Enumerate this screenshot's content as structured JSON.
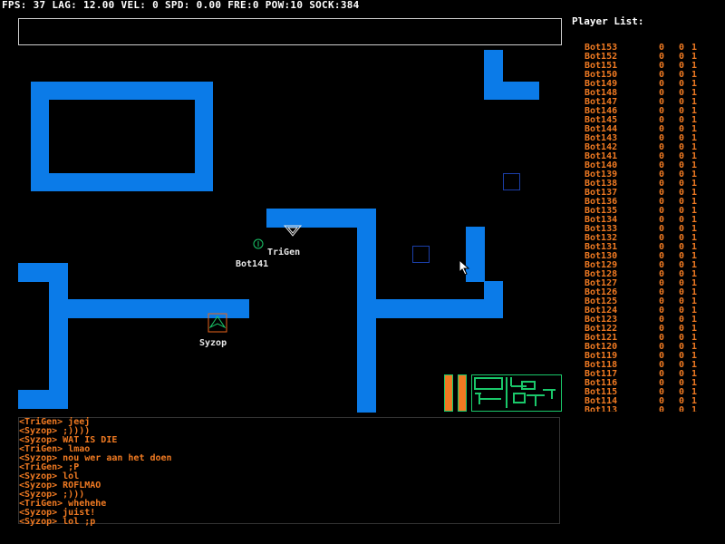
{
  "hud": {
    "text": "FPS: 37 LAG: 12.00 VEL: 0 SPD: 0.00 FRE:0 POW:10 SOCK:384"
  },
  "input": {
    "value": ""
  },
  "labels": {
    "trigen": "TriGen",
    "bot141": "Bot141",
    "syzop": "Syzop"
  },
  "player_list": {
    "title": "Player List:",
    "rows": [
      {
        "name": "Bot153",
        "a": "0",
        "b": "0",
        "c": "1"
      },
      {
        "name": "Bot152",
        "a": "0",
        "b": "0",
        "c": "1"
      },
      {
        "name": "Bot151",
        "a": "0",
        "b": "0",
        "c": "1"
      },
      {
        "name": "Bot150",
        "a": "0",
        "b": "0",
        "c": "1"
      },
      {
        "name": "Bot149",
        "a": "0",
        "b": "0",
        "c": "1"
      },
      {
        "name": "Bot148",
        "a": "0",
        "b": "0",
        "c": "1"
      },
      {
        "name": "Bot147",
        "a": "0",
        "b": "0",
        "c": "1"
      },
      {
        "name": "Bot146",
        "a": "0",
        "b": "0",
        "c": "1"
      },
      {
        "name": "Bot145",
        "a": "0",
        "b": "0",
        "c": "1"
      },
      {
        "name": "Bot144",
        "a": "0",
        "b": "0",
        "c": "1"
      },
      {
        "name": "Bot143",
        "a": "0",
        "b": "0",
        "c": "1"
      },
      {
        "name": "Bot142",
        "a": "0",
        "b": "0",
        "c": "1"
      },
      {
        "name": "Bot141",
        "a": "0",
        "b": "0",
        "c": "1"
      },
      {
        "name": "Bot140",
        "a": "0",
        "b": "0",
        "c": "1"
      },
      {
        "name": "Bot139",
        "a": "0",
        "b": "0",
        "c": "1"
      },
      {
        "name": "Bot138",
        "a": "0",
        "b": "0",
        "c": "1"
      },
      {
        "name": "Bot137",
        "a": "0",
        "b": "0",
        "c": "1"
      },
      {
        "name": "Bot136",
        "a": "0",
        "b": "0",
        "c": "1"
      },
      {
        "name": "Bot135",
        "a": "0",
        "b": "0",
        "c": "1"
      },
      {
        "name": "Bot134",
        "a": "0",
        "b": "0",
        "c": "1"
      },
      {
        "name": "Bot133",
        "a": "0",
        "b": "0",
        "c": "1"
      },
      {
        "name": "Bot132",
        "a": "0",
        "b": "0",
        "c": "1"
      },
      {
        "name": "Bot131",
        "a": "0",
        "b": "0",
        "c": "1"
      },
      {
        "name": "Bot130",
        "a": "0",
        "b": "0",
        "c": "1"
      },
      {
        "name": "Bot129",
        "a": "0",
        "b": "0",
        "c": "1"
      },
      {
        "name": "Bot128",
        "a": "0",
        "b": "0",
        "c": "1"
      },
      {
        "name": "Bot127",
        "a": "0",
        "b": "0",
        "c": "1"
      },
      {
        "name": "Bot126",
        "a": "0",
        "b": "0",
        "c": "1"
      },
      {
        "name": "Bot125",
        "a": "0",
        "b": "0",
        "c": "1"
      },
      {
        "name": "Bot124",
        "a": "0",
        "b": "0",
        "c": "1"
      },
      {
        "name": "Bot123",
        "a": "0",
        "b": "0",
        "c": "1"
      },
      {
        "name": "Bot122",
        "a": "0",
        "b": "0",
        "c": "1"
      },
      {
        "name": "Bot121",
        "a": "0",
        "b": "0",
        "c": "1"
      },
      {
        "name": "Bot120",
        "a": "0",
        "b": "0",
        "c": "1"
      },
      {
        "name": "Bot119",
        "a": "0",
        "b": "0",
        "c": "1"
      },
      {
        "name": "Bot118",
        "a": "0",
        "b": "0",
        "c": "1"
      },
      {
        "name": "Bot117",
        "a": "0",
        "b": "0",
        "c": "1"
      },
      {
        "name": "Bot116",
        "a": "0",
        "b": "0",
        "c": "1"
      },
      {
        "name": "Bot115",
        "a": "0",
        "b": "0",
        "c": "1"
      },
      {
        "name": "Bot114",
        "a": "0",
        "b": "0",
        "c": "1"
      },
      {
        "name": "Bot113",
        "a": "0",
        "b": "0",
        "c": "1"
      }
    ]
  },
  "chat": {
    "lines": [
      "<TriGen> jeej",
      "<Syzop> ;))))",
      "<Syzop> WAT IS DIE",
      "<TriGen> lmao",
      "<Syzop> nou wer aan het doen",
      "<TriGen> ;P",
      "<Syzop> lol",
      "<Syzop> ROFLMAO",
      "<Syzop> ;)))",
      "<TriGen> whehehe",
      "<Syzop> juist!",
      "<Syzop> lol ;p"
    ]
  },
  "colors": {
    "wall": "#0b7be8",
    "text_orange": "#f07a22",
    "minimap_green": "#1ac86a",
    "bar_orange": "#f07a22"
  }
}
